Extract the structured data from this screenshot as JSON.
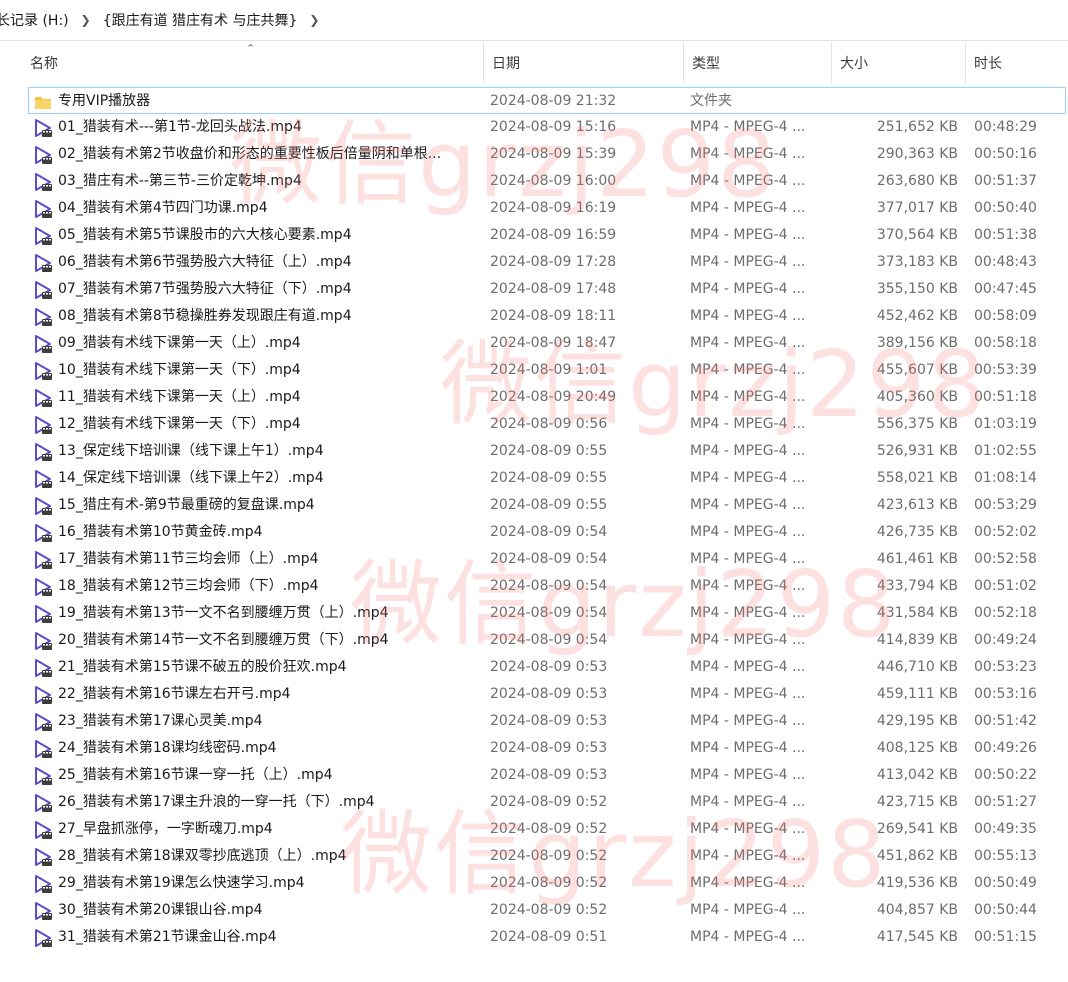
{
  "breadcrumb": {
    "drive": "长记录 (H:)",
    "folder": "{跟庄有道 猎庄有术 与庄共舞}"
  },
  "columns": {
    "name": "名称",
    "date": "日期",
    "type": "类型",
    "size": "大小",
    "duration": "时长"
  },
  "watermark": "微信grzj298",
  "colors": {
    "selection_border": "#99d1ff",
    "video_icon": "#5b4fc9",
    "folder_icon": "#f4c542",
    "watermark": "#f57878"
  },
  "rows": [
    {
      "icon": "folder-icon",
      "name": "专用VIP播放器",
      "date": "2024-08-09 21:32",
      "type": "文件夹",
      "size": "",
      "duration": ""
    },
    {
      "icon": "video-file-icon",
      "name": "01_猎装有术---第1节-龙回头战法.mp4",
      "date": "2024-08-09 15:16",
      "type": "MP4 - MPEG-4 ...",
      "size": "251,652 KB",
      "duration": "00:48:29"
    },
    {
      "icon": "video-file-icon",
      "name": "02_猎装有术第2节收盘价和形态的重要性板后倍量阴和单根...",
      "date": "2024-08-09 15:39",
      "type": "MP4 - MPEG-4 ...",
      "size": "290,363 KB",
      "duration": "00:50:16"
    },
    {
      "icon": "video-file-icon",
      "name": "03_猎庄有术--第三节-三价定乾坤.mp4",
      "date": "2024-08-09 16:00",
      "type": "MP4 - MPEG-4 ...",
      "size": "263,680 KB",
      "duration": "00:51:37"
    },
    {
      "icon": "video-file-icon",
      "name": "04_猎装有术第4节四门功课.mp4",
      "date": "2024-08-09 16:19",
      "type": "MP4 - MPEG-4 ...",
      "size": "377,017 KB",
      "duration": "00:50:40"
    },
    {
      "icon": "video-file-icon",
      "name": "05_猎装有术第5节课股市的六大核心要素.mp4",
      "date": "2024-08-09 16:59",
      "type": "MP4 - MPEG-4 ...",
      "size": "370,564 KB",
      "duration": "00:51:38"
    },
    {
      "icon": "video-file-icon",
      "name": "06_猎装有术第6节强势股六大特征（上）.mp4",
      "date": "2024-08-09 17:28",
      "type": "MP4 - MPEG-4 ...",
      "size": "373,183 KB",
      "duration": "00:48:43"
    },
    {
      "icon": "video-file-icon",
      "name": "07_猎装有术第7节强势股六大特征（下）.mp4",
      "date": "2024-08-09 17:48",
      "type": "MP4 - MPEG-4 ...",
      "size": "355,150 KB",
      "duration": "00:47:45"
    },
    {
      "icon": "video-file-icon",
      "name": "08_猎装有术第8节稳操胜券发现跟庄有道.mp4",
      "date": "2024-08-09 18:11",
      "type": "MP4 - MPEG-4 ...",
      "size": "452,462 KB",
      "duration": "00:58:09"
    },
    {
      "icon": "video-file-icon",
      "name": "09_猎装有术线下课第一天（上）.mp4",
      "date": "2024-08-09 18:47",
      "type": "MP4 - MPEG-4 ...",
      "size": "389,156 KB",
      "duration": "00:58:18"
    },
    {
      "icon": "video-file-icon",
      "name": "10_猎装有术线下课第一天（下）.mp4",
      "date": "2024-08-09 1:01",
      "type": "MP4 - MPEG-4 ...",
      "size": "455,607 KB",
      "duration": "00:53:39"
    },
    {
      "icon": "video-file-icon",
      "name": "11_猎装有术线下课第一天（上）.mp4",
      "date": "2024-08-09 20:49",
      "type": "MP4 - MPEG-4 ...",
      "size": "405,360 KB",
      "duration": "00:51:18"
    },
    {
      "icon": "video-file-icon",
      "name": "12_猎装有术线下课第一天（下）.mp4",
      "date": "2024-08-09 0:56",
      "type": "MP4 - MPEG-4 ...",
      "size": "556,375 KB",
      "duration": "01:03:19"
    },
    {
      "icon": "video-file-icon",
      "name": "13_保定线下培训课（线下课上午1）.mp4",
      "date": "2024-08-09 0:55",
      "type": "MP4 - MPEG-4 ...",
      "size": "526,931 KB",
      "duration": "01:02:55"
    },
    {
      "icon": "video-file-icon",
      "name": "14_保定线下培训课（线下课上午2）.mp4",
      "date": "2024-08-09 0:55",
      "type": "MP4 - MPEG-4 ...",
      "size": "558,021 KB",
      "duration": "01:08:14"
    },
    {
      "icon": "video-file-icon",
      "name": "15_猎庄有术-第9节最重磅的复盘课.mp4",
      "date": "2024-08-09 0:55",
      "type": "MP4 - MPEG-4 ...",
      "size": "423,613 KB",
      "duration": "00:53:29"
    },
    {
      "icon": "video-file-icon",
      "name": "16_猎装有术第10节黄金砖.mp4",
      "date": "2024-08-09 0:54",
      "type": "MP4 - MPEG-4 ...",
      "size": "426,735 KB",
      "duration": "00:52:02"
    },
    {
      "icon": "video-file-icon",
      "name": "17_猎装有术第11节三均会师（上）.mp4",
      "date": "2024-08-09 0:54",
      "type": "MP4 - MPEG-4 ...",
      "size": "461,461 KB",
      "duration": "00:52:58"
    },
    {
      "icon": "video-file-icon",
      "name": "18_猎装有术第12节三均会师（下）.mp4",
      "date": "2024-08-09 0:54",
      "type": "MP4 - MPEG-4 ...",
      "size": "433,794 KB",
      "duration": "00:51:02"
    },
    {
      "icon": "video-file-icon",
      "name": "19_猎装有术第13节一文不名到腰缠万贯（上）.mp4",
      "date": "2024-08-09 0:54",
      "type": "MP4 - MPEG-4 ...",
      "size": "431,584 KB",
      "duration": "00:52:18"
    },
    {
      "icon": "video-file-icon",
      "name": "20_猎装有术第14节一文不名到腰缠万贯（下）.mp4",
      "date": "2024-08-09 0:54",
      "type": "MP4 - MPEG-4 ...",
      "size": "414,839 KB",
      "duration": "00:49:24"
    },
    {
      "icon": "video-file-icon",
      "name": "21_猎装有术第15节课不破五的股价狂欢.mp4",
      "date": "2024-08-09 0:53",
      "type": "MP4 - MPEG-4 ...",
      "size": "446,710 KB",
      "duration": "00:53:23"
    },
    {
      "icon": "video-file-icon",
      "name": "22_猎装有术第16节课左右开弓.mp4",
      "date": "2024-08-09 0:53",
      "type": "MP4 - MPEG-4 ...",
      "size": "459,111 KB",
      "duration": "00:53:16"
    },
    {
      "icon": "video-file-icon",
      "name": "23_猎装有术第17课心灵美.mp4",
      "date": "2024-08-09 0:53",
      "type": "MP4 - MPEG-4 ...",
      "size": "429,195 KB",
      "duration": "00:51:42"
    },
    {
      "icon": "video-file-icon",
      "name": "24_猎装有术第18课均线密码.mp4",
      "date": "2024-08-09 0:53",
      "type": "MP4 - MPEG-4 ...",
      "size": "408,125 KB",
      "duration": "00:49:26"
    },
    {
      "icon": "video-file-icon",
      "name": "25_猎装有术第16节课一穿一托（上）.mp4",
      "date": "2024-08-09 0:53",
      "type": "MP4 - MPEG-4 ...",
      "size": "413,042 KB",
      "duration": "00:50:22"
    },
    {
      "icon": "video-file-icon",
      "name": "26_猎装有术第17课主升浪的一穿一托（下）.mp4",
      "date": "2024-08-09 0:52",
      "type": "MP4 - MPEG-4 ...",
      "size": "423,715 KB",
      "duration": "00:51:27"
    },
    {
      "icon": "video-file-icon",
      "name": "27_早盘抓涨停，一字断魂刀.mp4",
      "date": "2024-08-09 0:52",
      "type": "MP4 - MPEG-4 ...",
      "size": "269,541 KB",
      "duration": "00:49:35"
    },
    {
      "icon": "video-file-icon",
      "name": "28_猎装有术第18课双零抄底逃顶（上）.mp4",
      "date": "2024-08-09 0:52",
      "type": "MP4 - MPEG-4 ...",
      "size": "451,862 KB",
      "duration": "00:55:13"
    },
    {
      "icon": "video-file-icon",
      "name": "29_猎装有术第19课怎么快速学习.mp4",
      "date": "2024-08-09 0:52",
      "type": "MP4 - MPEG-4 ...",
      "size": "419,536 KB",
      "duration": "00:50:49"
    },
    {
      "icon": "video-file-icon",
      "name": "30_猎装有术第20课银山谷.mp4",
      "date": "2024-08-09 0:52",
      "type": "MP4 - MPEG-4 ...",
      "size": "404,857 KB",
      "duration": "00:50:44"
    },
    {
      "icon": "video-file-icon",
      "name": "31_猎装有术第21节课金山谷.mp4",
      "date": "2024-08-09 0:51",
      "type": "MP4 - MPEG-4 ...",
      "size": "417,545 KB",
      "duration": "00:51:15"
    }
  ]
}
